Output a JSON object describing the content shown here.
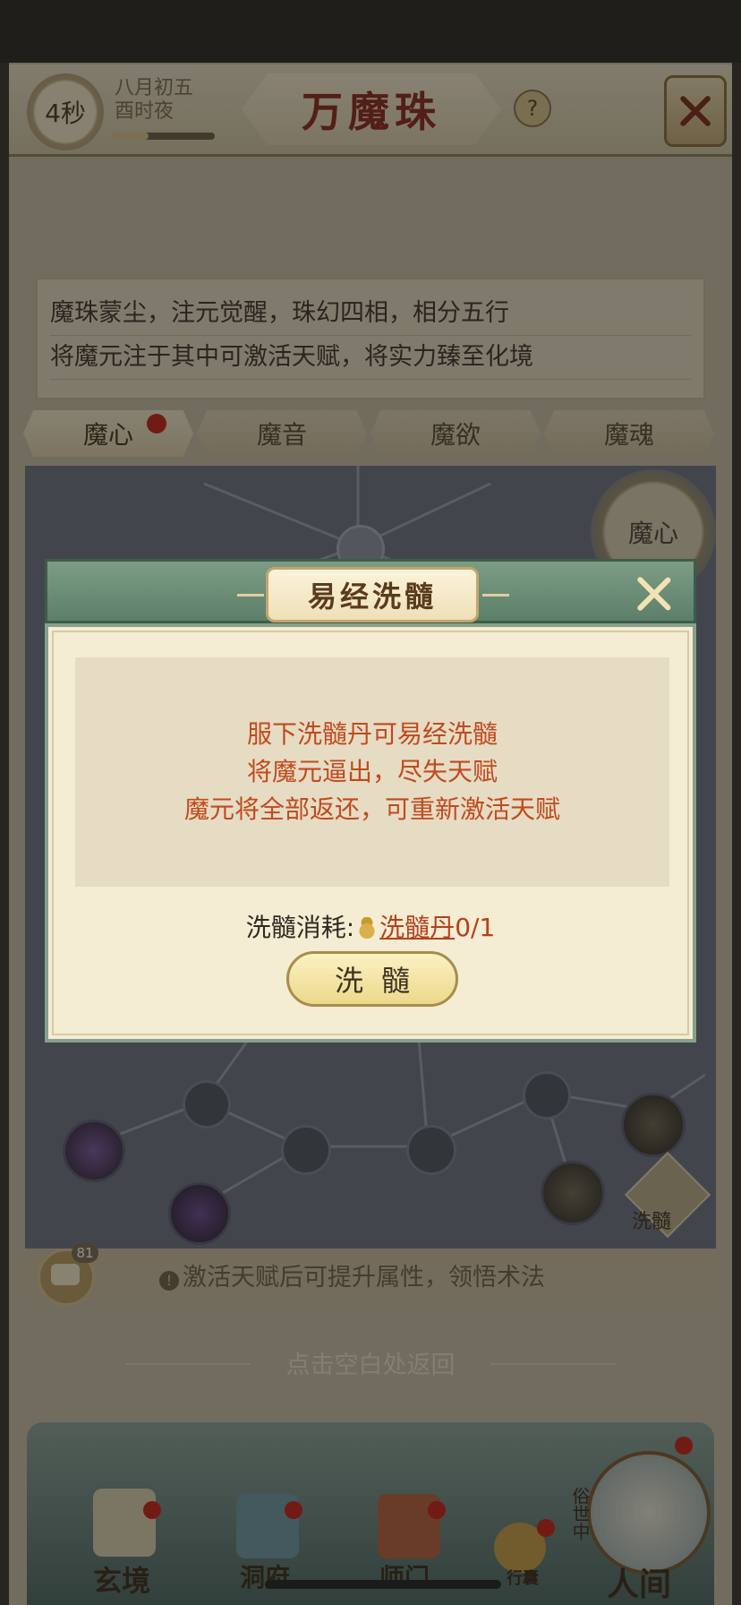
{
  "status": {
    "timer": "4秒",
    "date_line1": "八月初五",
    "date_line2": "酉时夜"
  },
  "header": {
    "title": "万魔珠",
    "help_icon": "?"
  },
  "intro": {
    "line1": "魔珠蒙尘，注元觉醒，珠幻四相，相分五行",
    "line2": "将魔元注于其中可激活天赋，将实力臻至化境"
  },
  "tabs": [
    {
      "label": "魔心",
      "active": true,
      "dot": true
    },
    {
      "label": "魔音"
    },
    {
      "label": "魔欲"
    },
    {
      "label": "魔魂"
    }
  ],
  "map": {
    "mode_badge": "魔心",
    "wash_label": "洗髓"
  },
  "hint": {
    "text": "激活天赋后可提升属性，领悟术法"
  },
  "chat": {
    "badge": "81"
  },
  "return_hint": "点击空白处返回",
  "modal": {
    "title": "易经洗髓",
    "info": [
      "服下洗髓丹可易经洗髓",
      "将魔元逼出，尽失天赋",
      "魔元将全部返还，可重新激活天赋"
    ],
    "cost_label": "洗髓消耗:",
    "cost_item": "洗髓丹",
    "cost_count": "0/1",
    "button": "洗髓"
  },
  "nav": {
    "items": [
      "玄境",
      "洞府",
      "师门",
      "行囊",
      "人间"
    ],
    "side_label": "俗世中"
  },
  "colors": {
    "accent_red": "#c14a1e",
    "modal_green": "#6f8f78",
    "notify_dot": "#c8221a"
  }
}
